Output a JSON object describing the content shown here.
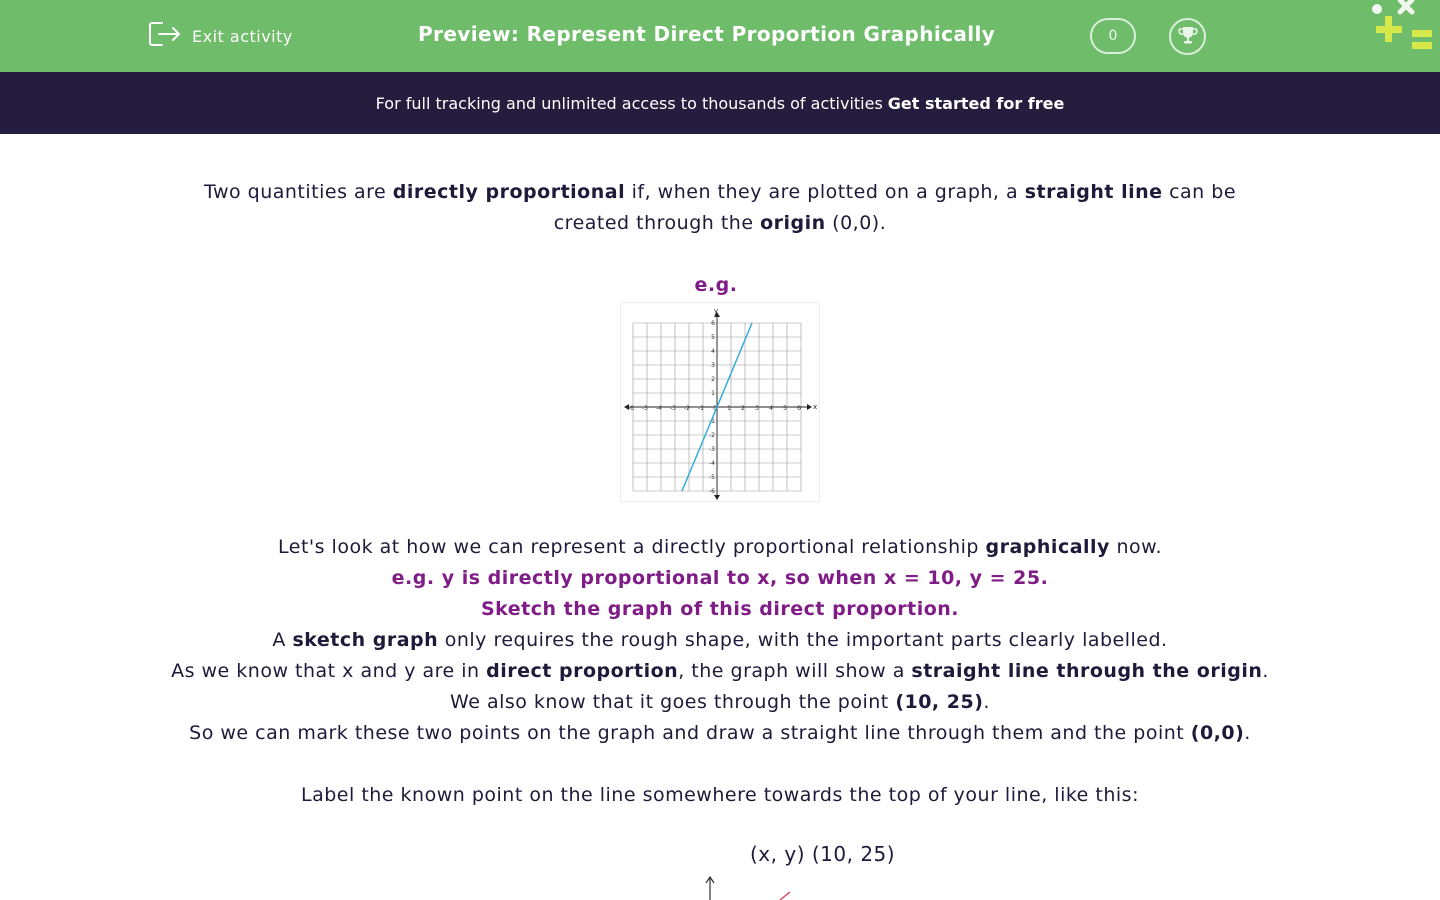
{
  "header": {
    "exit_label": "Exit activity",
    "title": "Preview: Represent Direct Proportion Graphically",
    "score": "0",
    "colors": {
      "topbar": "#6fbc6b",
      "banner": "#241d3d",
      "accent": "#7f1c85"
    },
    "icons": {
      "exit": "exit-icon",
      "trophy": "trophy-icon",
      "logo": "logo-icon"
    }
  },
  "banner": {
    "text": "For full tracking and unlimited access to thousands of activities",
    "cta": "Get started for free"
  },
  "intro": {
    "l1_a": "Two quantities are ",
    "l1_b": "directly proportional",
    "l1_c": " if, when they are plotted on a graph, a ",
    "l1_d": "straight line",
    "l1_e": " can be",
    "l2_a": "created through the ",
    "l2_b": "origin",
    "l2_c": " (0,0)."
  },
  "example_label": "e.g.",
  "example_graph": {
    "x_ticks": [
      "-6",
      "-5",
      "-4",
      "-3",
      "-2",
      "-1",
      "0",
      "1",
      "2",
      "3",
      "4",
      "5",
      "6"
    ],
    "y_ticks": [
      "6",
      "5",
      "4",
      "3",
      "2",
      "1",
      "-1",
      "-2",
      "-3",
      "-4",
      "-5",
      "-6"
    ],
    "x_axis": "x",
    "y_axis": "y",
    "line_color": "#29a9d9"
  },
  "body": {
    "l1_a": "Let's look at how we can represent a directly proportional relationship ",
    "l1_b": "graphically",
    "l1_c": " now.",
    "l2": "e.g. y is directly proportional to x, so when x = 10, y = 25.",
    "l3": "Sketch the graph of this direct proportion.",
    "l4_a": "A ",
    "l4_b": "sketch graph",
    "l4_c": " only requires the rough shape, with the important parts clearly labelled.",
    "l5_a": "As we know that x and y are in ",
    "l5_b": "direct proportion",
    "l5_c": ", the graph will show a ",
    "l5_d": "straight line through the origin",
    "l5_e": ".",
    "l6_a": "We also know that it goes through the point ",
    "l6_b": "(10, 25)",
    "l6_c": ".",
    "l7_a": "So we can mark these two points on the graph and draw a straight line through them and the point ",
    "l7_b": "(0,0)",
    "l7_c": ".",
    "l8": "Label the known point on the line somewhere towards the top of your line, like this:",
    "point_label": "(x, y) (10, 25)"
  }
}
